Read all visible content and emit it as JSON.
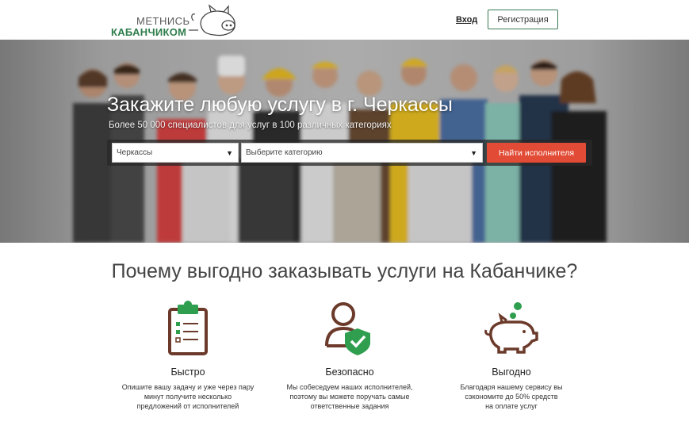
{
  "header": {
    "logo_line1": "МЕТНИСЬ",
    "logo_line2": "КАБАНЧИКОМ",
    "login_label": "Вход",
    "register_label": "Регистрация"
  },
  "hero": {
    "title": "Закажите любую услугу в г. Черкассы",
    "subtitle": "Более 50 000 специалистов для услуг в 100 различных категориях",
    "city_select_value": "Черкассы",
    "category_select_value": "Выберите категорию",
    "find_button_label": "Найти исполнителя"
  },
  "benefits": {
    "section_title": "Почему выгодно заказывать услуги на Кабанчике?",
    "items": [
      {
        "icon": "clipboard-icon",
        "title": "Быстро",
        "text": "Опишите вашу задачу и уже через пару\nминут получите несколько\nпредложений от исполнителей"
      },
      {
        "icon": "user-shield-icon",
        "title": "Безопасно",
        "text": "Мы собеседуем наших исполнителей,\nпоэтому вы можете поручать самые\nответственные задания"
      },
      {
        "icon": "piggy-bank-icon",
        "title": "Выгодно",
        "text": "Благодаря нашему сервису вы\nсэкономите до 50% средств\nна оплате услуг"
      }
    ]
  },
  "colors": {
    "brand_green": "#2e7d4b",
    "accent_red": "#e24b35",
    "icon_brown": "#6b3a2a",
    "icon_green": "#2f9e4f"
  }
}
